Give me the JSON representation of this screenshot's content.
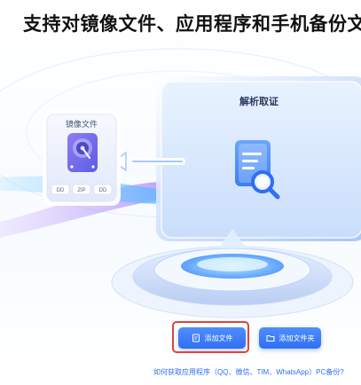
{
  "headline": "支持对镜像文件、应用程序和手机备份文",
  "image_card": {
    "title": "镜像文件",
    "formats": [
      "DD",
      "ZIP",
      "DD"
    ]
  },
  "analysis_panel": {
    "title": "解析取证"
  },
  "actions": {
    "add_file_label": "添加文件",
    "add_folder_label": "添加文件夹"
  },
  "help_link": "如何获取应用程序（QQ、微信、TIM、WhatsApp）PC备份?",
  "colors": {
    "accent": "#2f6ff2",
    "highlight": "#e0433a"
  }
}
